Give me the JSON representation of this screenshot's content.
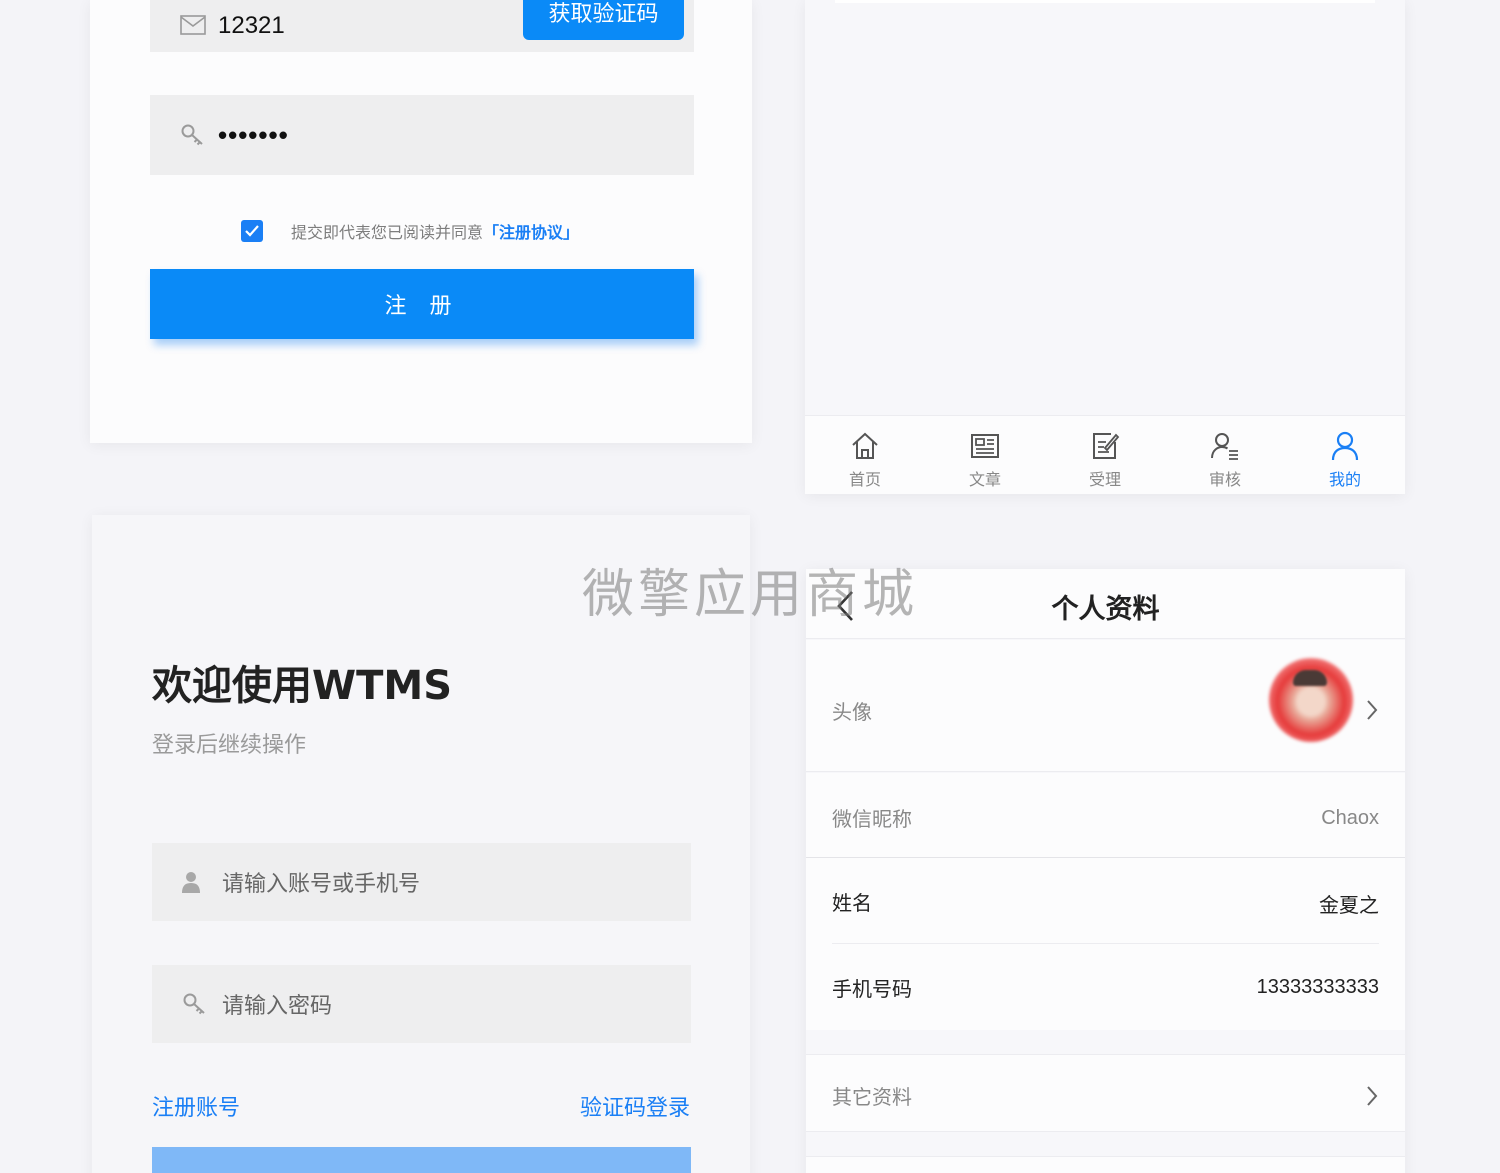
{
  "register": {
    "email_value": "12321",
    "get_code_label": "获取验证码",
    "password_value": "•••••••",
    "agree_text": "提交即代表您已阅读并同意",
    "agree_link": "「注册协议」",
    "submit_label": "注 册"
  },
  "tabbar": {
    "items": [
      {
        "label": "首页",
        "icon": "home-icon"
      },
      {
        "label": "文章",
        "icon": "article-icon"
      },
      {
        "label": "受理",
        "icon": "edit-doc-icon"
      },
      {
        "label": "审核",
        "icon": "user-list-icon"
      },
      {
        "label": "我的",
        "icon": "user-icon"
      }
    ],
    "active_index": 4,
    "active_color": "#1a7ff5"
  },
  "login": {
    "title": "欢迎使用WTMS",
    "subtitle": "登录后继续操作",
    "account_placeholder": "请输入账号或手机号",
    "password_placeholder": "请输入密码",
    "register_link": "注册账号",
    "code_login_link": "验证码登录"
  },
  "profile": {
    "title": "个人资料",
    "avatar_label": "头像",
    "nickname_label": "微信昵称",
    "nickname_value": "Chaox",
    "name_label": "姓名",
    "name_value": "金夏之",
    "phone_label": "手机号码",
    "phone_value": "13333333333",
    "other_label": "其它资料"
  },
  "watermark": "微擎应用商城",
  "colors": {
    "primary": "#0a8af7",
    "link": "#1a7ff5",
    "disabled_button": "#7fb8f7"
  }
}
